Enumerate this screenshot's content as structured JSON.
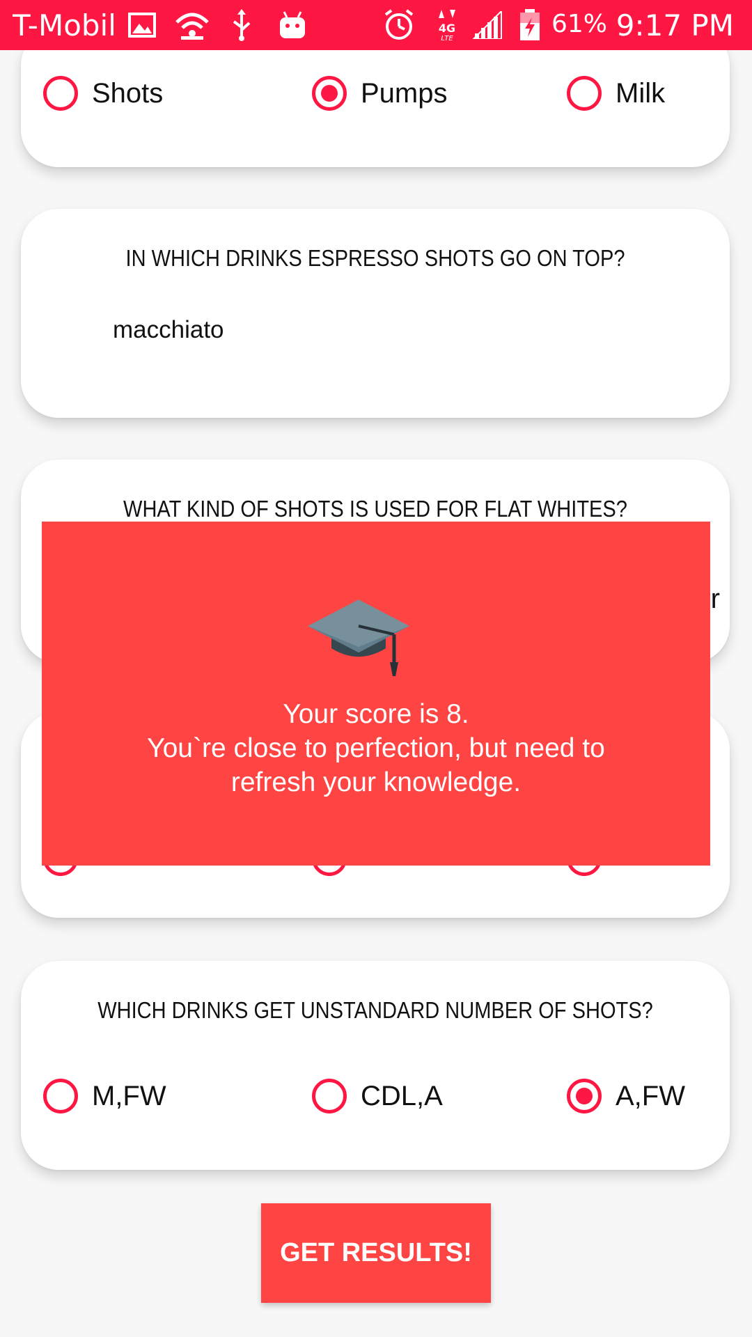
{
  "status_bar": {
    "carrier": "T-Mobile",
    "battery": "61%",
    "time": "9:17 PM",
    "network": "4G LTE"
  },
  "q_top": {
    "options": [
      "Shots",
      "Pumps",
      "Milk"
    ],
    "selected": "Pumps"
  },
  "q_espresso": {
    "question": "IN WHICH DRINKS ESPRESSO SHOTS GO ON TOP?",
    "answer": "macchiato"
  },
  "q_flat": {
    "question": "WHAT KIND OF SHOTS IS USED FOR FLAT WHITES?",
    "peek_char": "r"
  },
  "q_unstandard": {
    "question": "WHICH DRINKS GET UNSTANDARD NUMBER OF SHOTS?",
    "options": [
      "M,FW",
      "CDL,A",
      "A,FW"
    ],
    "selected": "A,FW"
  },
  "result_popup": {
    "line1": "Your score is 8.",
    "line2": "You`re close to perfection, but need to",
    "line3": "refresh your knowledge.",
    "icon": "graduation-cap-icon"
  },
  "get_results_label": "GET RESULTS!",
  "colors": {
    "status_bar": "#ff1744",
    "accent": "#ff1744",
    "popup": "#ff4444"
  }
}
